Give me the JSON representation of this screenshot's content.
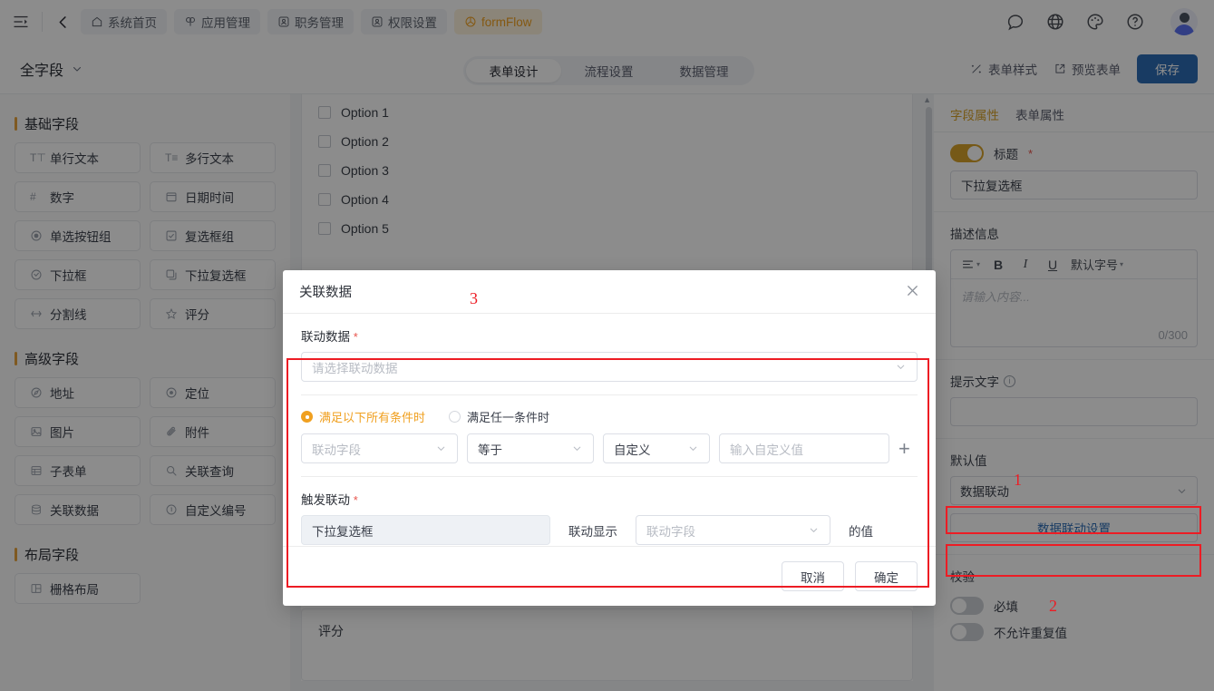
{
  "header": {
    "collapse_icon": "panel-collapse-icon",
    "back_icon": "chevron-left-icon",
    "breadcrumbs": [
      {
        "label": "系统首页",
        "icon": "home-icon",
        "active": false
      },
      {
        "label": "应用管理",
        "icon": "apps-icon",
        "active": false
      },
      {
        "label": "职务管理",
        "icon": "user-badge-icon",
        "active": false
      },
      {
        "label": "权限设置",
        "icon": "user-badge-icon",
        "active": false
      },
      {
        "label": "formFlow",
        "icon": "flow-icon",
        "active": true
      }
    ],
    "actions": [
      {
        "name": "message-icon"
      },
      {
        "name": "globe-icon"
      },
      {
        "name": "palette-icon"
      },
      {
        "name": "help-icon"
      }
    ],
    "avatar": "user-avatar"
  },
  "subheader": {
    "form_name": "全字段",
    "tabs": [
      {
        "label": "表单设计",
        "active": true
      },
      {
        "label": "流程设置",
        "active": false
      },
      {
        "label": "数据管理",
        "active": false
      }
    ],
    "style_button": "表单样式",
    "preview_button": "预览表单",
    "save_button": "保存"
  },
  "palette": {
    "groups": [
      {
        "title": "基础字段",
        "fields": [
          {
            "label": "单行文本",
            "icon": "text-single-icon"
          },
          {
            "label": "多行文本",
            "icon": "text-multi-icon"
          },
          {
            "label": "数字",
            "icon": "hash-icon"
          },
          {
            "label": "日期时间",
            "icon": "calendar-icon"
          },
          {
            "label": "单选按钮组",
            "icon": "radio-icon"
          },
          {
            "label": "复选框组",
            "icon": "checkbox-icon"
          },
          {
            "label": "下拉框",
            "icon": "dropdown-icon"
          },
          {
            "label": "下拉复选框",
            "icon": "dropdown-multi-icon"
          },
          {
            "label": "分割线",
            "icon": "divider-icon"
          },
          {
            "label": "评分",
            "icon": "star-icon"
          }
        ]
      },
      {
        "title": "高级字段",
        "fields": [
          {
            "label": "地址",
            "icon": "address-icon"
          },
          {
            "label": "定位",
            "icon": "location-icon"
          },
          {
            "label": "图片",
            "icon": "image-icon"
          },
          {
            "label": "附件",
            "icon": "attachment-icon"
          },
          {
            "label": "子表单",
            "icon": "subform-icon"
          },
          {
            "label": "关联查询",
            "icon": "search-icon"
          },
          {
            "label": "关联数据",
            "icon": "database-icon"
          },
          {
            "label": "自定义编号",
            "icon": "number-icon"
          }
        ]
      },
      {
        "title": "布局字段",
        "fields": [
          {
            "label": "栅格布局",
            "icon": "grid-icon"
          }
        ]
      }
    ]
  },
  "canvas": {
    "options": [
      "Option 1",
      "Option 2",
      "Option 3",
      "Option 4",
      "Option 5"
    ],
    "bottom_field_label": "评分"
  },
  "properties": {
    "tabs": [
      {
        "label": "字段属性",
        "active": true
      },
      {
        "label": "表单属性",
        "active": false
      }
    ],
    "title_toggle_on": true,
    "title_label": "标题",
    "title_required": "*",
    "title_value": "下拉复选框",
    "description_label": "描述信息",
    "editor_toolbar": {
      "align": "≡",
      "bold": "B",
      "italic": "I",
      "underline": "U",
      "font_size": "默认字号"
    },
    "editor_placeholder": "请输入内容...",
    "editor_counter": "0/300",
    "hint_label": "提示文字",
    "hint_value": "",
    "default_label": "默认值",
    "default_value": "数据联动",
    "linkage_settings_button": "数据联动设置",
    "validation_label": "校验",
    "validations": [
      {
        "label": "必填",
        "on": false
      },
      {
        "label": "不允许重复值",
        "on": false
      }
    ]
  },
  "modal": {
    "title": "关联数据",
    "close_icon": "close-icon",
    "linkage_data_label": "联动数据",
    "linkage_data_required": "*",
    "linkage_data_placeholder": "请选择联动数据",
    "condition_modes": [
      {
        "label": "满足以下所有条件时",
        "selected": true
      },
      {
        "label": "满足任一条件时",
        "selected": false
      }
    ],
    "condition_row": {
      "field_placeholder": "联动字段",
      "operator_value": "等于",
      "value_type": "自定义",
      "custom_value_placeholder": "输入自定义值",
      "add_icon": "plus-icon"
    },
    "trigger_label": "触发联动",
    "trigger_required": "*",
    "trigger_field_value": "下拉复选框",
    "trigger_show_text": "联动显示",
    "trigger_field_placeholder": "联动字段",
    "trigger_suffix_text": "的值",
    "cancel_button": "取消",
    "confirm_button": "确定"
  },
  "annotations": [
    {
      "number": "1"
    },
    {
      "number": "2"
    },
    {
      "number": "3"
    }
  ],
  "colors": {
    "accent_orange": "#f0a020",
    "brand_blue": "#2d6cb5",
    "annotation_red": "#ed1c24",
    "gold": "#d8a32b"
  }
}
